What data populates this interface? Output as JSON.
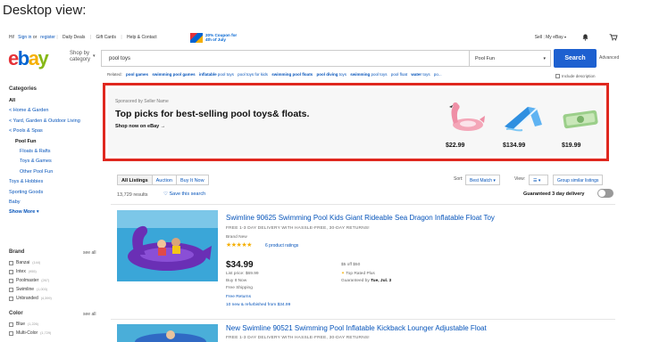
{
  "caption": "Desktop view:",
  "header": {
    "signin_prefix": "Hi!",
    "signin_link": "Sign in",
    "signin_or": "or",
    "register_link": "register",
    "links": [
      "Daily Deals",
      "Gift Cards",
      "Help & Contact"
    ],
    "coupon_line1": "20% Coupon for",
    "coupon_line2": "4th of July",
    "sell": "Sell",
    "my_ebay": "My eBay"
  },
  "logo": {
    "e": "e",
    "b": "b",
    "a": "a",
    "y": "y"
  },
  "search": {
    "shop_by_1": "Shop by",
    "shop_by_2": "category",
    "query": "pool toys",
    "category": "Pool Fun",
    "button": "Search",
    "advanced": "Advanced",
    "include_description": "Include description"
  },
  "related": {
    "label": "Related:",
    "items": [
      {
        "bold": "pool games",
        "rest": ""
      },
      {
        "bold": "swimming pool games",
        "rest": ""
      },
      {
        "bold": "inflatable",
        "rest": "pool toys"
      },
      {
        "bold": "",
        "rest": "pool toys for kids"
      },
      {
        "bold": "swimming pool floats",
        "rest": ""
      },
      {
        "bold": "pool diving",
        "rest": "toys"
      },
      {
        "bold": "swimming",
        "rest": "pool toys"
      },
      {
        "bold": "",
        "rest": "pool float"
      },
      {
        "bold": "water",
        "rest": "toys"
      },
      {
        "bold": "",
        "rest": "po..."
      }
    ]
  },
  "sidebar": {
    "heading": "Categories",
    "items": [
      {
        "label": "All",
        "kind": "all"
      },
      {
        "label": "< Home & Garden",
        "kind": "link"
      },
      {
        "label": "< Yard, Garden & Outdoor Living",
        "kind": "link"
      },
      {
        "label": "< Pools & Spas",
        "kind": "link"
      },
      {
        "label": "Pool Fun",
        "kind": "cur"
      },
      {
        "label": "Floats & Rafts",
        "kind": "sub"
      },
      {
        "label": "Toys & Games",
        "kind": "sub"
      },
      {
        "label": "Other Pool Fun",
        "kind": "sub"
      },
      {
        "label": "Toys & Hobbies",
        "kind": "link"
      },
      {
        "label": "Sporting Goods",
        "kind": "link"
      },
      {
        "label": "Baby",
        "kind": "link"
      }
    ],
    "show_more": "Show More",
    "brand_heading": "Brand",
    "see_all": "see all",
    "brands": [
      {
        "label": "Banzai",
        "count": "(144)"
      },
      {
        "label": "Intex",
        "count": "(955)"
      },
      {
        "label": "Poolmaster",
        "count": "(267)"
      },
      {
        "label": "Swimline",
        "count": "(1,003)"
      },
      {
        "label": "Unbranded",
        "count": "(4,399)"
      }
    ],
    "color_heading": "Color",
    "colors": [
      {
        "label": "Blue",
        "count": "(1,226)"
      },
      {
        "label": "Multi-Color",
        "count": "(1,729)"
      }
    ]
  },
  "promo": {
    "sponsor": "Sponsored by Seller Name",
    "title": "Top picks for best-selling pool toys& floats.",
    "cta": "Shop now on eBay",
    "prices": [
      "$22.99",
      "$134.99",
      "$19.99"
    ],
    "border_color": "#e0281f"
  },
  "listing": {
    "tabs": [
      "All Listings",
      "Auction",
      "Buy It Now"
    ],
    "sort_label": "Sort:",
    "sort_value": "Best Match",
    "view_label": "View:",
    "group_similar": "Group similar listings",
    "results": "13,729 results",
    "save_search": "Save this search",
    "guaranteed": "Guaranteed 3 day delivery"
  },
  "items": [
    {
      "title": "Swimline 90625 Swimming Pool Kids Giant Rideable Sea Dragon Inflatable Float Toy",
      "subtitle": "FREE 1-3 DAY DELIVERY WITH HASSLE-FREE, 30-DAY RETURNS!",
      "condition": "Brand New",
      "stars": "★★★★★",
      "ratings": "6 product ratings",
      "price": "$34.99",
      "list_price": "List price: $69.99",
      "buy_it_now": "Buy It Now",
      "free_shipping": "Free Shipping",
      "free_returns": "Free Returns",
      "refurb": "10 new & refurbished from $34.99",
      "off": "$5 off $50",
      "top_rated": "Top Rated Plus",
      "guaranteed_by": "Guaranteed by",
      "guaranteed_date": "Tue, Jul. 3"
    },
    {
      "title": "New Swimline 90521 Swimming Pool Inflatable Kickback Lounger Adjustable Float",
      "subtitle": "FREE 1-3 DAY DELIVERY WITH HASSLE-FREE, 30-DAY RETURNS!"
    }
  ]
}
